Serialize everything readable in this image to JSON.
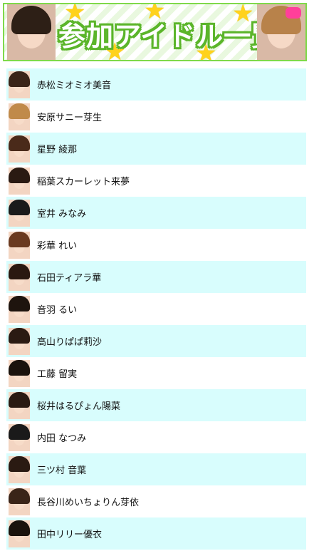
{
  "header": {
    "title": "参加アイドル一覧"
  },
  "idols": [
    {
      "name": "赤松ミオミオ美音",
      "hair": "#3a2418"
    },
    {
      "name": "安原サニー芽生",
      "hair": "#c08a4a"
    },
    {
      "name": "星野 綾那",
      "hair": "#4a2a1a"
    },
    {
      "name": "稲葉スカーレット来夢",
      "hair": "#2a1a12"
    },
    {
      "name": "室井 みなみ",
      "hair": "#1a1a1a"
    },
    {
      "name": "彩華 れい",
      "hair": "#6a3a20"
    },
    {
      "name": "石田ティアラ華",
      "hair": "#2a1810"
    },
    {
      "name": "音羽 るい",
      "hair": "#1e140e"
    },
    {
      "name": "高山りぱぱ莉沙",
      "hair": "#2a1a12"
    },
    {
      "name": "工藤 留実",
      "hair": "#1a120c"
    },
    {
      "name": "桜井はるぴょん陽菜",
      "hair": "#2a1a12"
    },
    {
      "name": "内田 なつみ",
      "hair": "#1a1a1a"
    },
    {
      "name": "三ツ村 音葉",
      "hair": "#2a1a12"
    },
    {
      "name": "長谷川めいちょりん芽依",
      "hair": "#3a2418"
    },
    {
      "name": "田中リリー優衣",
      "hair": "#1a120c"
    }
  ]
}
